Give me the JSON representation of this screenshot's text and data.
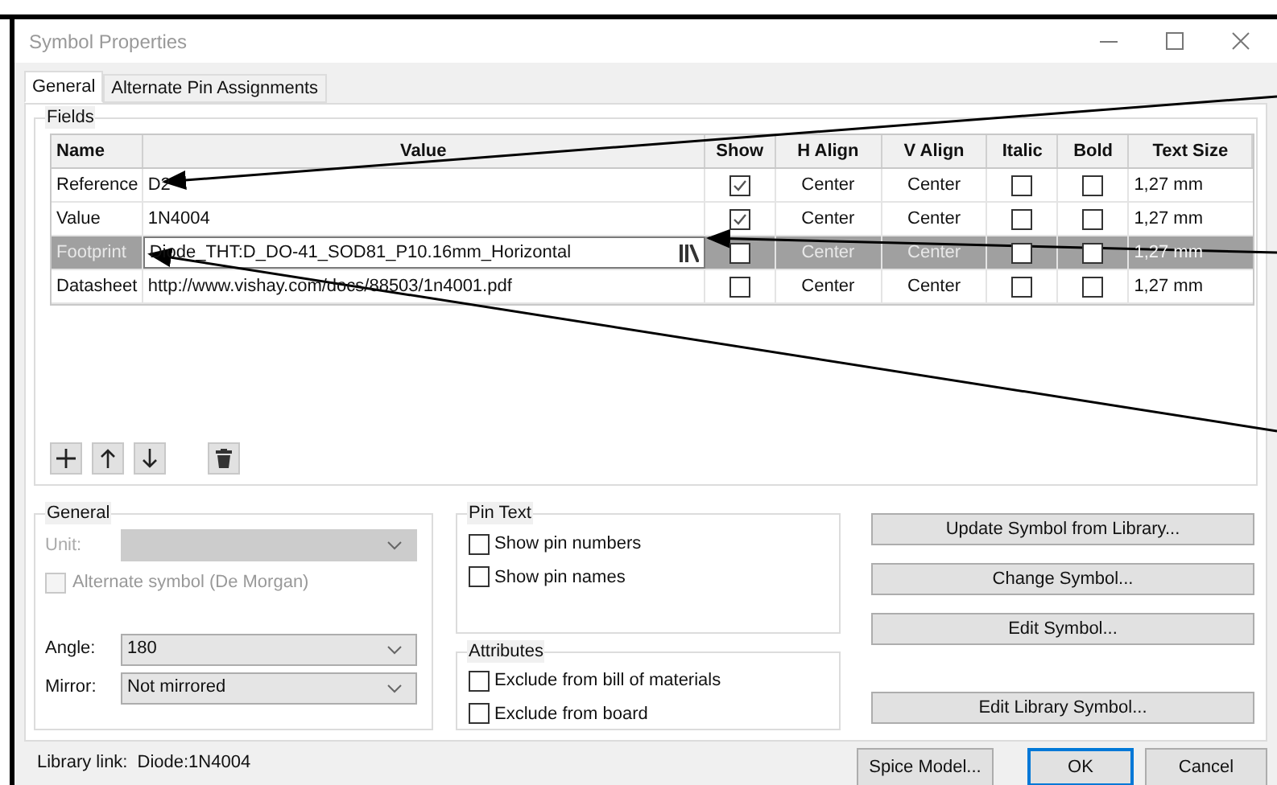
{
  "window": {
    "title": "Symbol Properties"
  },
  "tabs": [
    {
      "label": "General",
      "selected": true
    },
    {
      "label": "Alternate Pin Assignments",
      "selected": false
    }
  ],
  "fields": {
    "title": "Fields",
    "columns": [
      "Name",
      "Value",
      "Show",
      "H Align",
      "V Align",
      "Italic",
      "Bold",
      "Text Size"
    ],
    "rows": [
      {
        "name": "Reference",
        "value": "D2",
        "show": true,
        "h_align": "Center",
        "v_align": "Center",
        "italic": false,
        "bold": false,
        "text_size": "1,27 mm",
        "selected": false
      },
      {
        "name": "Value",
        "value": "1N4004",
        "show": true,
        "h_align": "Center",
        "v_align": "Center",
        "italic": false,
        "bold": false,
        "text_size": "1,27 mm",
        "selected": false
      },
      {
        "name": "Footprint",
        "value": "Diode_THT:D_DO-41_SOD81_P10.16mm_Horizontal",
        "show": false,
        "h_align": "Center",
        "v_align": "Center",
        "italic": false,
        "bold": false,
        "text_size": "1,27 mm",
        "selected": true
      },
      {
        "name": "Datasheet",
        "value": "http://www.vishay.com/docs/88503/1n4001.pdf",
        "show": false,
        "h_align": "Center",
        "v_align": "Center",
        "italic": false,
        "bold": false,
        "text_size": "1,27 mm",
        "selected": false
      }
    ]
  },
  "general": {
    "title": "General",
    "unit_label": "Unit:",
    "unit_disabled": true,
    "de_morgan": {
      "label": "Alternate symbol (De Morgan)",
      "checked": false,
      "disabled": true
    },
    "angle_label": "Angle:",
    "angle": "180",
    "mirror_label": "Mirror:",
    "mirror": "Not mirrored"
  },
  "pin_text": {
    "title": "Pin Text",
    "options": [
      {
        "label": "Show pin numbers",
        "checked": false
      },
      {
        "label": "Show pin names",
        "checked": false
      }
    ]
  },
  "attributes": {
    "title": "Attributes",
    "options": [
      {
        "label": "Exclude from bill of materials",
        "checked": false
      },
      {
        "label": "Exclude from board",
        "checked": false
      }
    ]
  },
  "side_buttons": [
    "Update Symbol from Library...",
    "Change Symbol...",
    "Edit Symbol..."
  ],
  "edit_library_button": "Edit Library Symbol...",
  "library_link": {
    "label": "Library link:",
    "value": "Diode:1N4004"
  },
  "footer_buttons": [
    {
      "label": "Spice Model...",
      "default": false
    },
    {
      "label": "OK",
      "default": true
    },
    {
      "label": "Cancel",
      "default": false
    }
  ]
}
